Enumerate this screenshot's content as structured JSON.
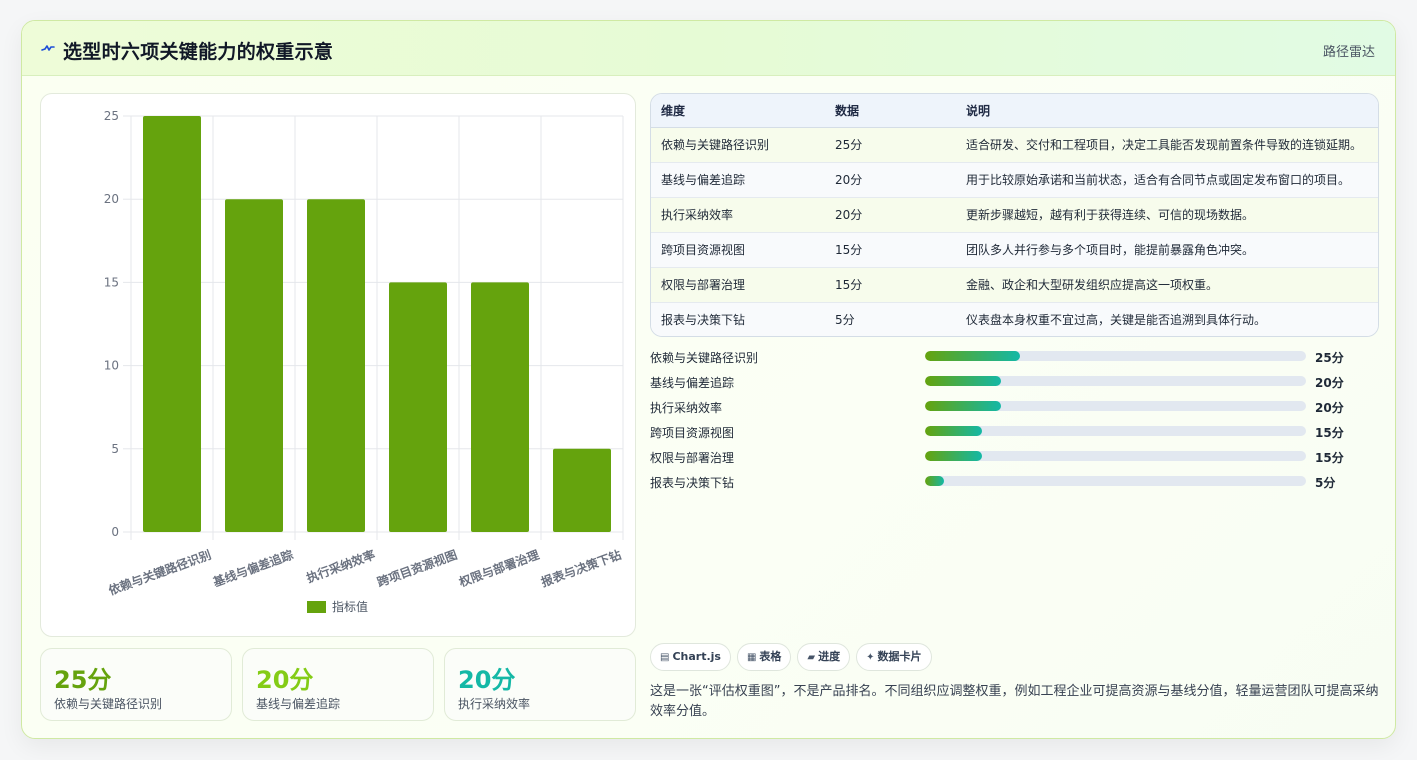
{
  "header": {
    "icon": "pulse-icon",
    "title": "选型时六项关键能力的权重示意",
    "tag": "路径雷达"
  },
  "colors": {
    "bar": "#65a30d",
    "accent_green": "#65a30d",
    "accent_lime": "#84cc16",
    "accent_teal": "#14b8a6"
  },
  "chart_data": {
    "type": "bar",
    "categories": [
      "依赖与关键路径识别",
      "基线与偏差追踪",
      "执行采纳效率",
      "跨项目资源视图",
      "权限与部署治理",
      "报表与决策下钻"
    ],
    "series": [
      {
        "name": "指标值",
        "values": [
          25,
          20,
          20,
          15,
          15,
          5
        ]
      }
    ],
    "ylim": [
      0,
      25
    ],
    "yticks": [
      "0",
      "5",
      "10",
      "15",
      "20",
      "25"
    ],
    "grid": true,
    "legend": "bottom"
  },
  "stats": [
    {
      "value": "25分",
      "label": "依赖与关键路径识别",
      "color": "#65a30d"
    },
    {
      "value": "20分",
      "label": "基线与偏差追踪",
      "color": "#84cc16"
    },
    {
      "value": "20分",
      "label": "执行采纳效率",
      "color": "#14b8a6"
    }
  ],
  "table": {
    "headers": [
      "维度",
      "数据",
      "说明"
    ],
    "rows": [
      [
        "依赖与关键路径识别",
        "25分",
        "适合研发、交付和工程项目，决定工具能否发现前置条件导致的连锁延期。"
      ],
      [
        "基线与偏差追踪",
        "20分",
        "用于比较原始承诺和当前状态，适合有合同节点或固定发布窗口的项目。"
      ],
      [
        "执行采纳效率",
        "20分",
        "更新步骤越短，越有利于获得连续、可信的现场数据。"
      ],
      [
        "跨项目资源视图",
        "15分",
        "团队多人并行参与多个项目时，能提前暴露角色冲突。"
      ],
      [
        "权限与部署治理",
        "15分",
        "金融、政企和大型研发组织应提高这一项权重。"
      ],
      [
        "报表与决策下钻",
        "5分",
        "仪表盘本身权重不宜过高，关键是能否追溯到具体行动。"
      ]
    ]
  },
  "progress": [
    {
      "label": "依赖与关键路径识别",
      "value": "25分",
      "fraction": 0.25
    },
    {
      "label": "基线与偏差追踪",
      "value": "20分",
      "fraction": 0.2
    },
    {
      "label": "执行采纳效率",
      "value": "20分",
      "fraction": 0.2
    },
    {
      "label": "跨项目资源视图",
      "value": "15分",
      "fraction": 0.15
    },
    {
      "label": "权限与部署治理",
      "value": "15分",
      "fraction": 0.15
    },
    {
      "label": "报表与决策下钻",
      "value": "5分",
      "fraction": 0.05
    }
  ],
  "chips": [
    {
      "icon": "chart-icon",
      "glyph": "▤",
      "label": "Chart.js"
    },
    {
      "icon": "table-icon",
      "glyph": "▦",
      "label": "表格"
    },
    {
      "icon": "progress-icon",
      "glyph": "▰",
      "label": "进度"
    },
    {
      "icon": "sparkle-icon",
      "glyph": "✦",
      "label": "数据卡片"
    }
  ],
  "note": "这是一张“评估权重图”，不是产品排名。不同组织应调整权重，例如工程企业可提高资源与基线分值，轻量运营团队可提高采纳效率分值。"
}
